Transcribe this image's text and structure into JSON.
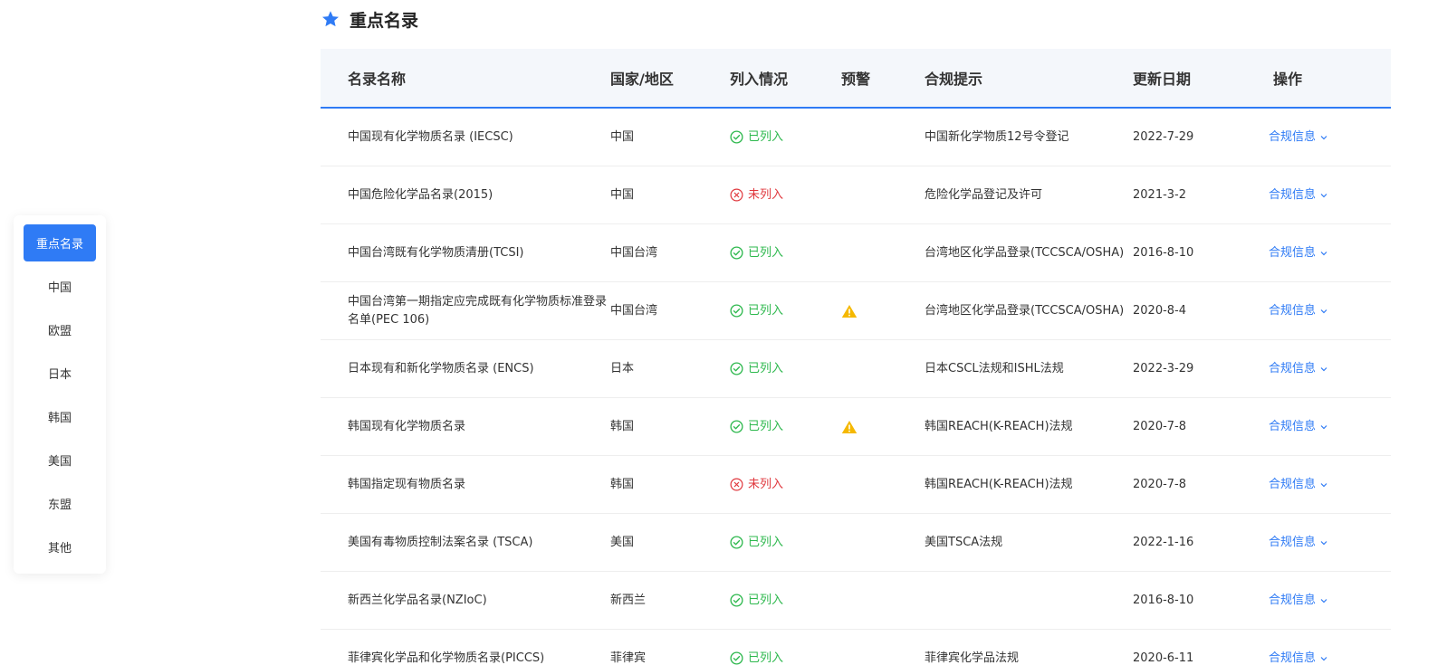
{
  "sidebar": {
    "items": [
      {
        "label": "重点名录",
        "active": true
      },
      {
        "label": "中国"
      },
      {
        "label": "欧盟"
      },
      {
        "label": "日本"
      },
      {
        "label": "韩国"
      },
      {
        "label": "美国"
      },
      {
        "label": "东盟"
      },
      {
        "label": "其他"
      }
    ]
  },
  "section": {
    "title": "重点名录",
    "icon": "star-icon"
  },
  "table": {
    "headers": [
      "名录名称",
      "国家/地区",
      "列入情况",
      "预警",
      "合规提示",
      "更新日期",
      "操作"
    ],
    "rows": [
      {
        "name": "中国现有化学物质名录 (IECSC)",
        "region": "中国",
        "status": "已列入",
        "listed": true,
        "warning": false,
        "tip": "中国新化学物质12号令登记",
        "date": "2022-7-29",
        "action": "合规信息"
      },
      {
        "name": "中国危险化学品名录(2015)",
        "region": "中国",
        "status": "未列入",
        "listed": false,
        "warning": false,
        "tip": "危险化学品登记及许可",
        "date": "2021-3-2",
        "action": "合规信息"
      },
      {
        "name": "中国台湾既有化学物质清册(TCSI)",
        "region": "中国台湾",
        "status": "已列入",
        "listed": true,
        "warning": false,
        "tip": "台湾地区化学品登录(TCCSCA/OSHA)",
        "date": "2016-8-10",
        "action": "合规信息"
      },
      {
        "name": "中国台湾第一期指定应完成既有化学物质标准登录名单(PEC 106)",
        "region": "中国台湾",
        "status": "已列入",
        "listed": true,
        "warning": true,
        "tip": "台湾地区化学品登录(TCCSCA/OSHA)",
        "date": "2020-8-4",
        "action": "合规信息"
      },
      {
        "name": "日本现有和新化学物质名录 (ENCS)",
        "region": "日本",
        "status": "已列入",
        "listed": true,
        "warning": false,
        "tip": "日本CSCL法规和ISHL法规",
        "date": "2022-3-29",
        "action": "合规信息"
      },
      {
        "name": "韩国现有化学物质名录",
        "region": "韩国",
        "status": "已列入",
        "listed": true,
        "warning": true,
        "tip": "韩国REACH(K-REACH)法规",
        "date": "2020-7-8",
        "action": "合规信息"
      },
      {
        "name": "韩国指定现有物质名录",
        "region": "韩国",
        "status": "未列入",
        "listed": false,
        "warning": false,
        "tip": "韩国REACH(K-REACH)法规",
        "date": "2020-7-8",
        "action": "合规信息"
      },
      {
        "name": "美国有毒物质控制法案名录 (TSCA)",
        "region": "美国",
        "status": "已列入",
        "listed": true,
        "warning": false,
        "tip": "美国TSCA法规",
        "date": "2022-1-16",
        "action": "合规信息"
      },
      {
        "name": "新西兰化学品名录(NZIoC)",
        "region": "新西兰",
        "status": "已列入",
        "listed": true,
        "warning": false,
        "tip": "",
        "date": "2016-8-10",
        "action": "合规信息"
      },
      {
        "name": "菲律宾化学品和化学物质名录(PICCS)",
        "region": "菲律宾",
        "status": "已列入",
        "listed": true,
        "warning": false,
        "tip": "菲律宾化学品法规",
        "date": "2020-6-11",
        "action": "合规信息"
      }
    ]
  },
  "colors": {
    "accent": "#2f7bf5",
    "listed": "#2db84d",
    "unlisted": "#e0383e",
    "warning": "#f5b800"
  }
}
